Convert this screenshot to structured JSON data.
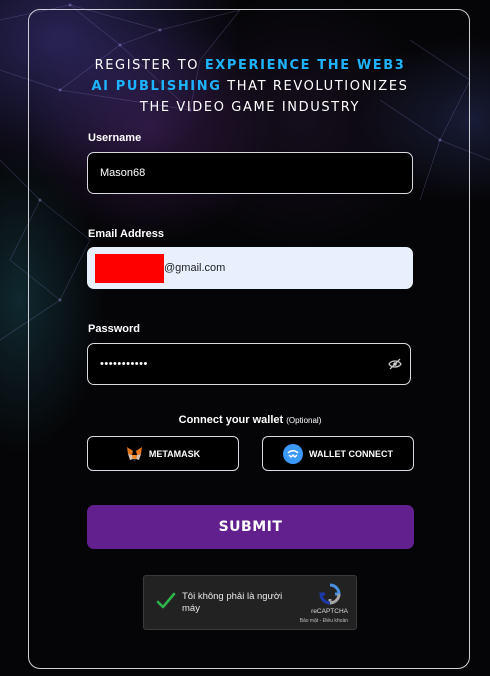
{
  "headline": {
    "line1_plain": "Register to ",
    "line1_accent": "experience the Web3",
    "line2_accent": "AI publishing",
    "line2_plain": " that revolutionizes",
    "line3_plain": "the video game industry"
  },
  "form": {
    "username": {
      "label": "Username",
      "value": "Mason68"
    },
    "email": {
      "label": "Email Address",
      "value_visible": "@gmail.com"
    },
    "password": {
      "label": "Password",
      "value": "•••••••••••"
    }
  },
  "wallet": {
    "title": "Connect your wallet",
    "optional": "(Optional)",
    "metamask_label": "METAMASK",
    "walletconnect_label": "WALLET CONNECT"
  },
  "submit_label": "SUBMIT",
  "captcha": {
    "text": "Tôi không phải là người máy",
    "brand": "reCAPTCHA",
    "links": "Bảo mật - Điều khoản"
  },
  "icons": {
    "eye": "eye-slash-icon",
    "metamask": "metamask-fox-icon",
    "walletconnect": "walletconnect-icon",
    "check": "checkmark-icon",
    "recaptcha": "recaptcha-logo-icon"
  },
  "colors": {
    "accent": "#1eb3ff",
    "submit": "#62208f",
    "email_autofill": "#e8f0fe",
    "redaction": "#ff0000",
    "check": "#2db34a"
  }
}
